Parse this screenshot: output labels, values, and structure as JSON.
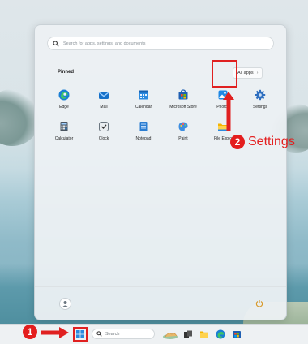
{
  "start_menu": {
    "search_placeholder": "Search for apps, settings, and documents",
    "pinned_label": "Pinned",
    "all_apps_label": "All apps",
    "apps": [
      {
        "label": "Edge",
        "icon": "edge-icon"
      },
      {
        "label": "Mail",
        "icon": "mail-icon"
      },
      {
        "label": "Calendar",
        "icon": "calendar-icon"
      },
      {
        "label": "Microsoft Store",
        "icon": "store-icon"
      },
      {
        "label": "Photos",
        "icon": "photos-icon"
      },
      {
        "label": "Settings",
        "icon": "gear-icon"
      },
      {
        "label": "Calculator",
        "icon": "calculator-icon"
      },
      {
        "label": "Clock",
        "icon": "clock-icon"
      },
      {
        "label": "Notepad",
        "icon": "notepad-icon"
      },
      {
        "label": "Paint",
        "icon": "paint-icon"
      },
      {
        "label": "File Explo",
        "icon": "folder-icon"
      }
    ]
  },
  "annotations": {
    "step1_number": "1",
    "step2_number": "2",
    "step2_text": "Settings",
    "highlight_color": "#e02020"
  },
  "taskbar": {
    "search_label": "Search"
  }
}
